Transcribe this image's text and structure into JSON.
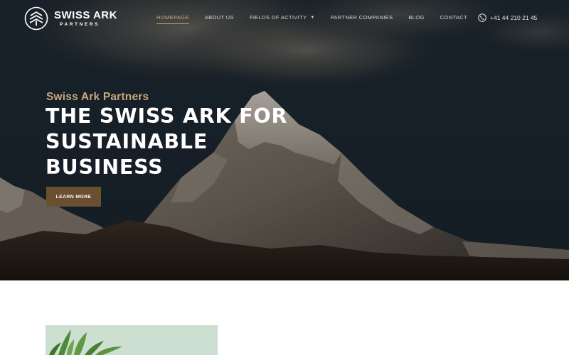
{
  "brand": {
    "name": "SWISS ARK",
    "subtitle": "PARTNERS",
    "icon": "ark-logo-icon"
  },
  "nav": {
    "items": [
      {
        "label": "HOMEPAGE",
        "active": true
      },
      {
        "label": "ABOUT US",
        "active": false
      },
      {
        "label": "FIELDS OF ACTIVITY",
        "active": false,
        "dropdown": true
      },
      {
        "label": "PARTNER COMPANIES",
        "active": false
      },
      {
        "label": "BLOG",
        "active": false
      },
      {
        "label": "CONTACT",
        "active": false
      }
    ]
  },
  "phone": {
    "icon": "phone-icon",
    "number": "+41 44 210 21 45"
  },
  "hero": {
    "eyebrow": "Swiss Ark Partners",
    "headline_line1": "THE SWISS ARK FOR",
    "headline_line2": "SUSTAINABLE",
    "headline_line3": "BUSINESS",
    "cta_label": "LEARN MORE"
  },
  "colors": {
    "accent": "#c9a77a",
    "button": "#6a4f31",
    "hero_sky": "#1c2730",
    "white": "#ffffff"
  }
}
